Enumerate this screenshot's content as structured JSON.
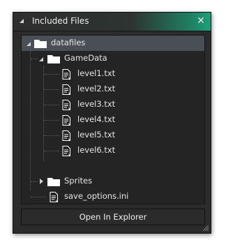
{
  "window": {
    "title": "Included Files",
    "close_glyph": "✕"
  },
  "tree": {
    "root": {
      "label": "datafiles",
      "icon": "folder-icon",
      "expanded": true
    },
    "gamedata": {
      "label": "GameData",
      "icon": "folder-icon",
      "expanded": true
    },
    "files": [
      "level1.txt",
      "level2.txt",
      "level3.txt",
      "level4.txt",
      "level5.txt",
      "level6.txt"
    ],
    "sprites": {
      "label": "Sprites",
      "icon": "folder-icon",
      "expanded": false
    },
    "options_file": {
      "label": "save_options.ini",
      "icon": "file-icon"
    }
  },
  "footer": {
    "open_explorer_label": "Open In Explorer"
  },
  "colors": {
    "accent": "#1ca07a",
    "panel": "#242424",
    "selection": "#4a4f55",
    "text": "#e6e6e6"
  }
}
